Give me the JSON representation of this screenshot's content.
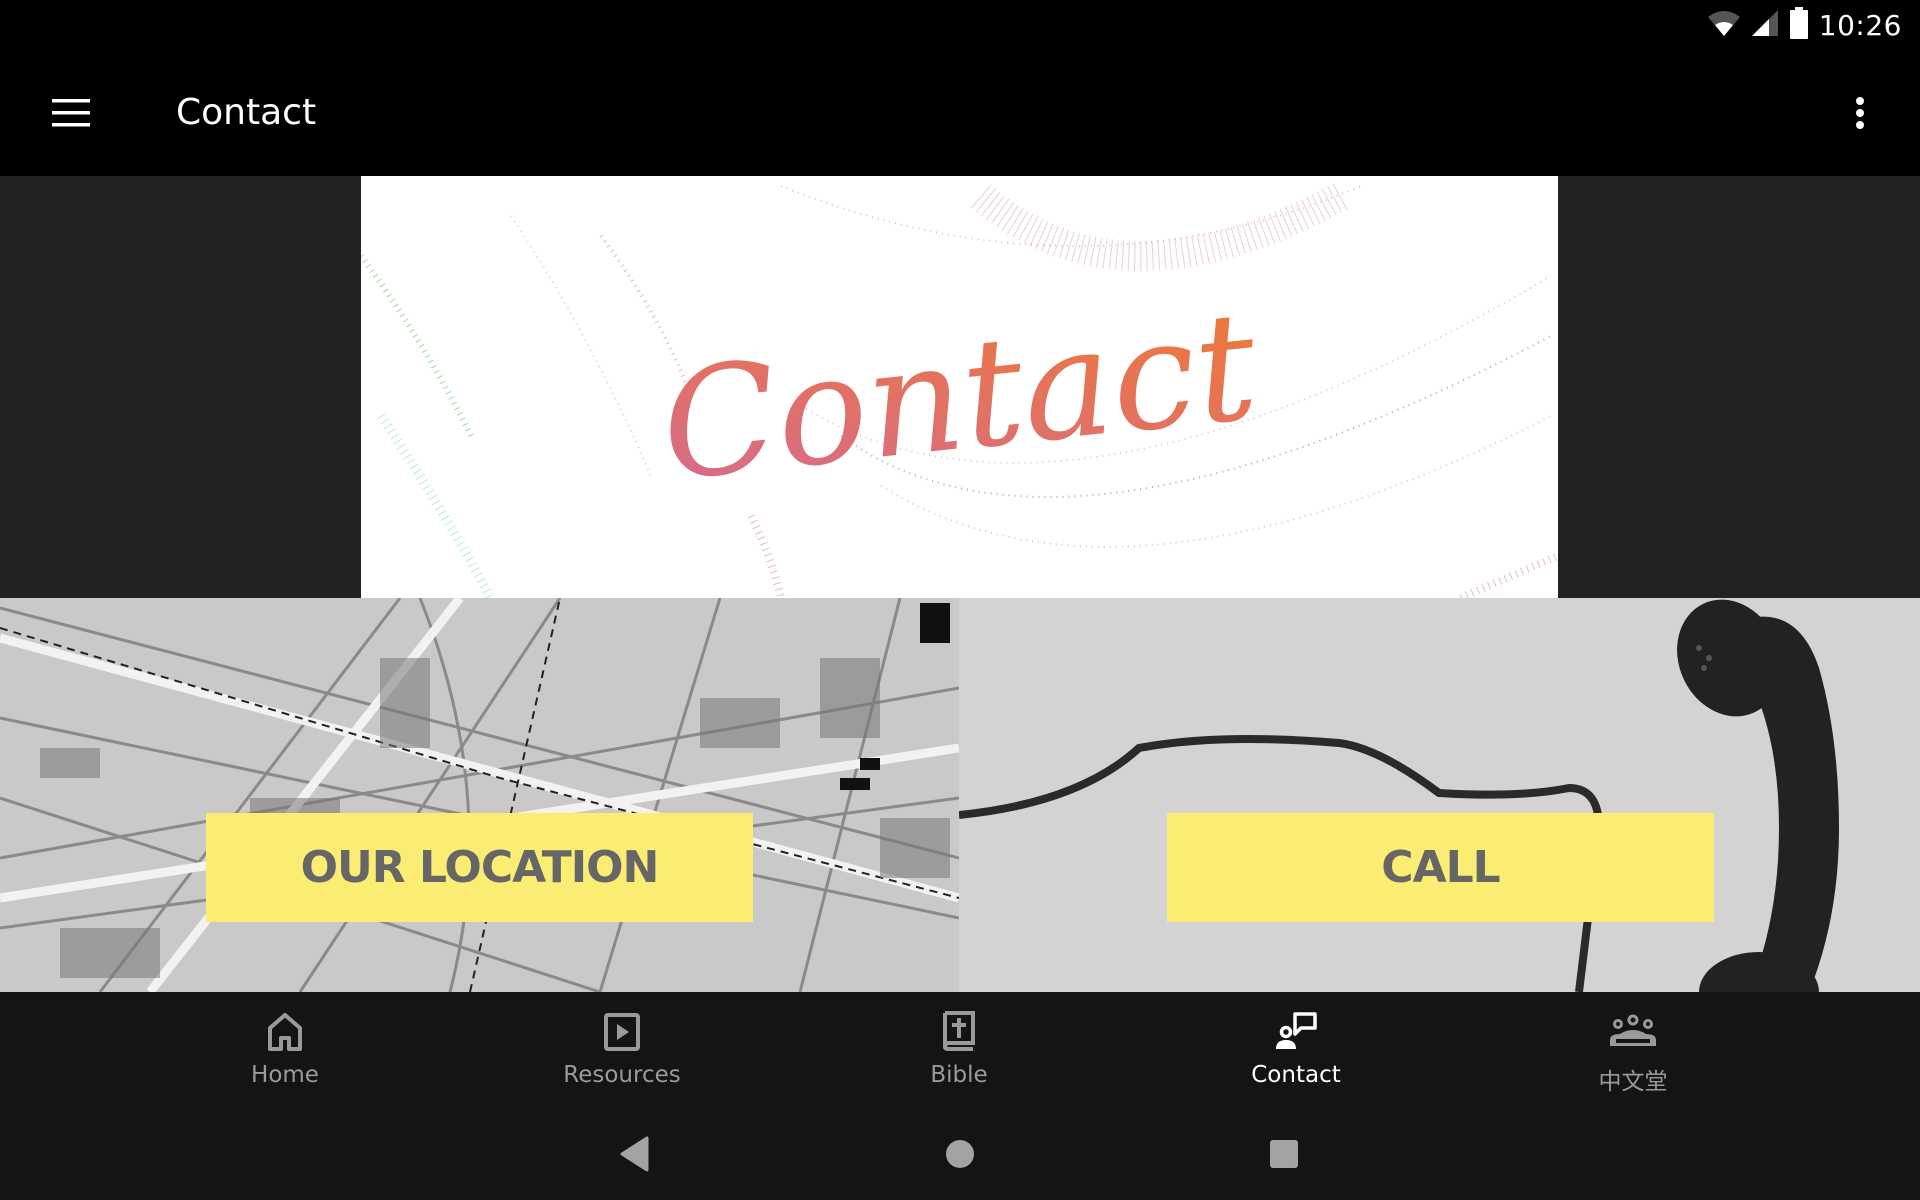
{
  "status_bar": {
    "time": "10:26",
    "icons": [
      "wifi-icon",
      "cell-signal-icon",
      "battery-icon"
    ]
  },
  "app_bar": {
    "title": "Contact",
    "menu_icon": "hamburger-menu-icon",
    "overflow_icon": "more-vertical-icon"
  },
  "banner": {
    "script_text": "Contact",
    "gradient_colors": [
      "#d46a94",
      "#f07a2e"
    ]
  },
  "tiles": [
    {
      "id": "location",
      "label": "OUR LOCATION",
      "background": "street-map-image"
    },
    {
      "id": "call",
      "label": "CALL",
      "background": "telephone-handset-image"
    }
  ],
  "colors": {
    "button_yellow": "#fbec73",
    "button_text": "#666666",
    "nav_active": "#ffffff",
    "nav_inactive": "#9a9a9a",
    "nav_background": "#131416"
  },
  "bottom_nav": {
    "active": "Contact",
    "items": [
      {
        "label": "Home",
        "icon": "home-icon"
      },
      {
        "label": "Resources",
        "icon": "video-play-icon"
      },
      {
        "label": "Bible",
        "icon": "bible-icon"
      },
      {
        "label": "Contact",
        "icon": "contact-chat-icon"
      },
      {
        "label": "中文堂",
        "icon": "group-icon"
      }
    ]
  },
  "system_nav": {
    "buttons": [
      "back-icon",
      "home-circle-icon",
      "recents-icon"
    ]
  }
}
